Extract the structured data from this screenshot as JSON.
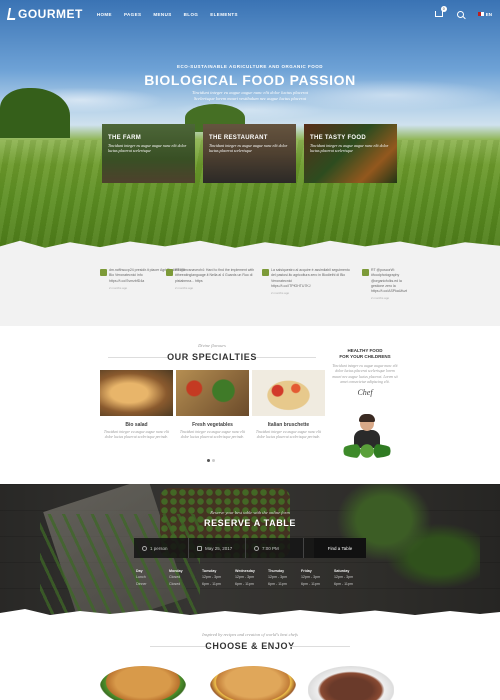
{
  "nav": {
    "logo": "GOURMET",
    "menu": [
      "HOME",
      "PAGES",
      "MENUS",
      "BLOG",
      "ELEMENTS"
    ],
    "cart_count": "0",
    "language": "EN"
  },
  "hero": {
    "kicker": "ECO-SUSTAINABLE AGRICULTURE AND ORGANIC FOOD",
    "title": "BIOLOGICAL FOOD PASSION",
    "subtitle_1": "Tincidunt integer eu augue augue nunc elit dolor luctus placerat",
    "subtitle_2": "Scelerisque lorem mauri vestibulum nec augue luctus placerat",
    "cards": [
      {
        "title": "THE FARM",
        "text": "Tincidunt integer eu augue augue nunc elit dolor luctus placerat scelerisque"
      },
      {
        "title": "THE RESTAURANT",
        "text": "Tincidunt integer eu augue augue nunc elit dolor luctus placerat scelerisque"
      },
      {
        "title": "THE TASTY FOOD",
        "text": "Tincidunt integer eu augue augue nunc elit dolor luctus placerat scelerisque"
      }
    ]
  },
  "tweets": [
    {
      "text": "dm.ncfthsucp24 presidir.it placer Agri Biodiethli di Bio Veronatecnici info",
      "link": "https://t.co/SvmzbfD4a",
      "time": "2 months ago"
    },
    {
      "text": "RT @mcsnaveoh4: Hard to find the implement with #theeatinglanguage.it Nella al 4 Guards un Ruo di pistabmna... https",
      "link": "",
      "time": "2 months ago"
    },
    {
      "text": "La salsiquestro al acquire è assimilabil seguimento del pastosi.ltc agricoltura zero in Biodiethl di Bio Veronatecnici",
      "link": "https://t.co/ITPfGHTU7KJ",
      "time": "2 months ago"
    },
    {
      "text": "RT @poscorW: #foodphotography @organicfolks.ed la gestione zero la",
      "link": "https://t.co/ASPkaUfuzt",
      "time": "2 months ago"
    }
  ],
  "specialties": {
    "kicker": "Divine flavours",
    "title": "OUR SPECIALTIES",
    "dishes": [
      {
        "name": "Bio salad",
        "desc": "Tincidunt integer eu augue augue nunc elit dolor luctus placerat scelerisque perinde."
      },
      {
        "name": "Fresh vegetables",
        "desc": "Tincidunt integer eu augue augue nunc elit dolor luctus placerat scelerisque perinde."
      },
      {
        "name": "Italian bruschette",
        "desc": "Tincidunt integer eu augue augue nunc elit dolor luctus placerat scelerisque perinde."
      }
    ],
    "healthy_title_1": "HEALTHY FOOD",
    "healthy_title_2": "FOR YOUR CHILDRENS",
    "healthy_text": "Tincidunt integer eu augue augue nunc elit dolor luctus placerat scelerisque lorem mauri nec augue luctus placerat. Lorem sit amet consectetur adipiscing elit.",
    "signature": "Chef"
  },
  "reservation": {
    "kicker": "Reserve your best table with the online form",
    "title": "RESERVE A TABLE",
    "people": "1 person",
    "date": "May 25, 2017",
    "time": "7:00 PM",
    "button": "Find a Table",
    "hours": [
      {
        "day": "Day",
        "lunch": "Lunch",
        "dinner": "Dinner"
      },
      {
        "day": "Monday",
        "lunch": "Closed",
        "dinner": "Closed"
      },
      {
        "day": "Tuesday",
        "lunch": "12pm - 3pm",
        "dinner": "6pm - 11pm"
      },
      {
        "day": "Wednesday",
        "lunch": "12pm - 3pm",
        "dinner": "6pm - 11pm"
      },
      {
        "day": "Thursday",
        "lunch": "12pm - 3pm",
        "dinner": "6pm - 11pm"
      },
      {
        "day": "Friday",
        "lunch": "12pm - 3pm",
        "dinner": "6pm - 11pm"
      },
      {
        "day": "Saturday",
        "lunch": "12pm - 3pm",
        "dinner": "6pm - 11pm"
      },
      {
        "day": "Sunday",
        "lunch": "12pm - 3pm",
        "dinner": "6pm - 11pm"
      }
    ]
  },
  "choose": {
    "kicker": "Inspired by recipes and creation of world's best chefs",
    "title": "CHOOSE & ENJOY"
  }
}
